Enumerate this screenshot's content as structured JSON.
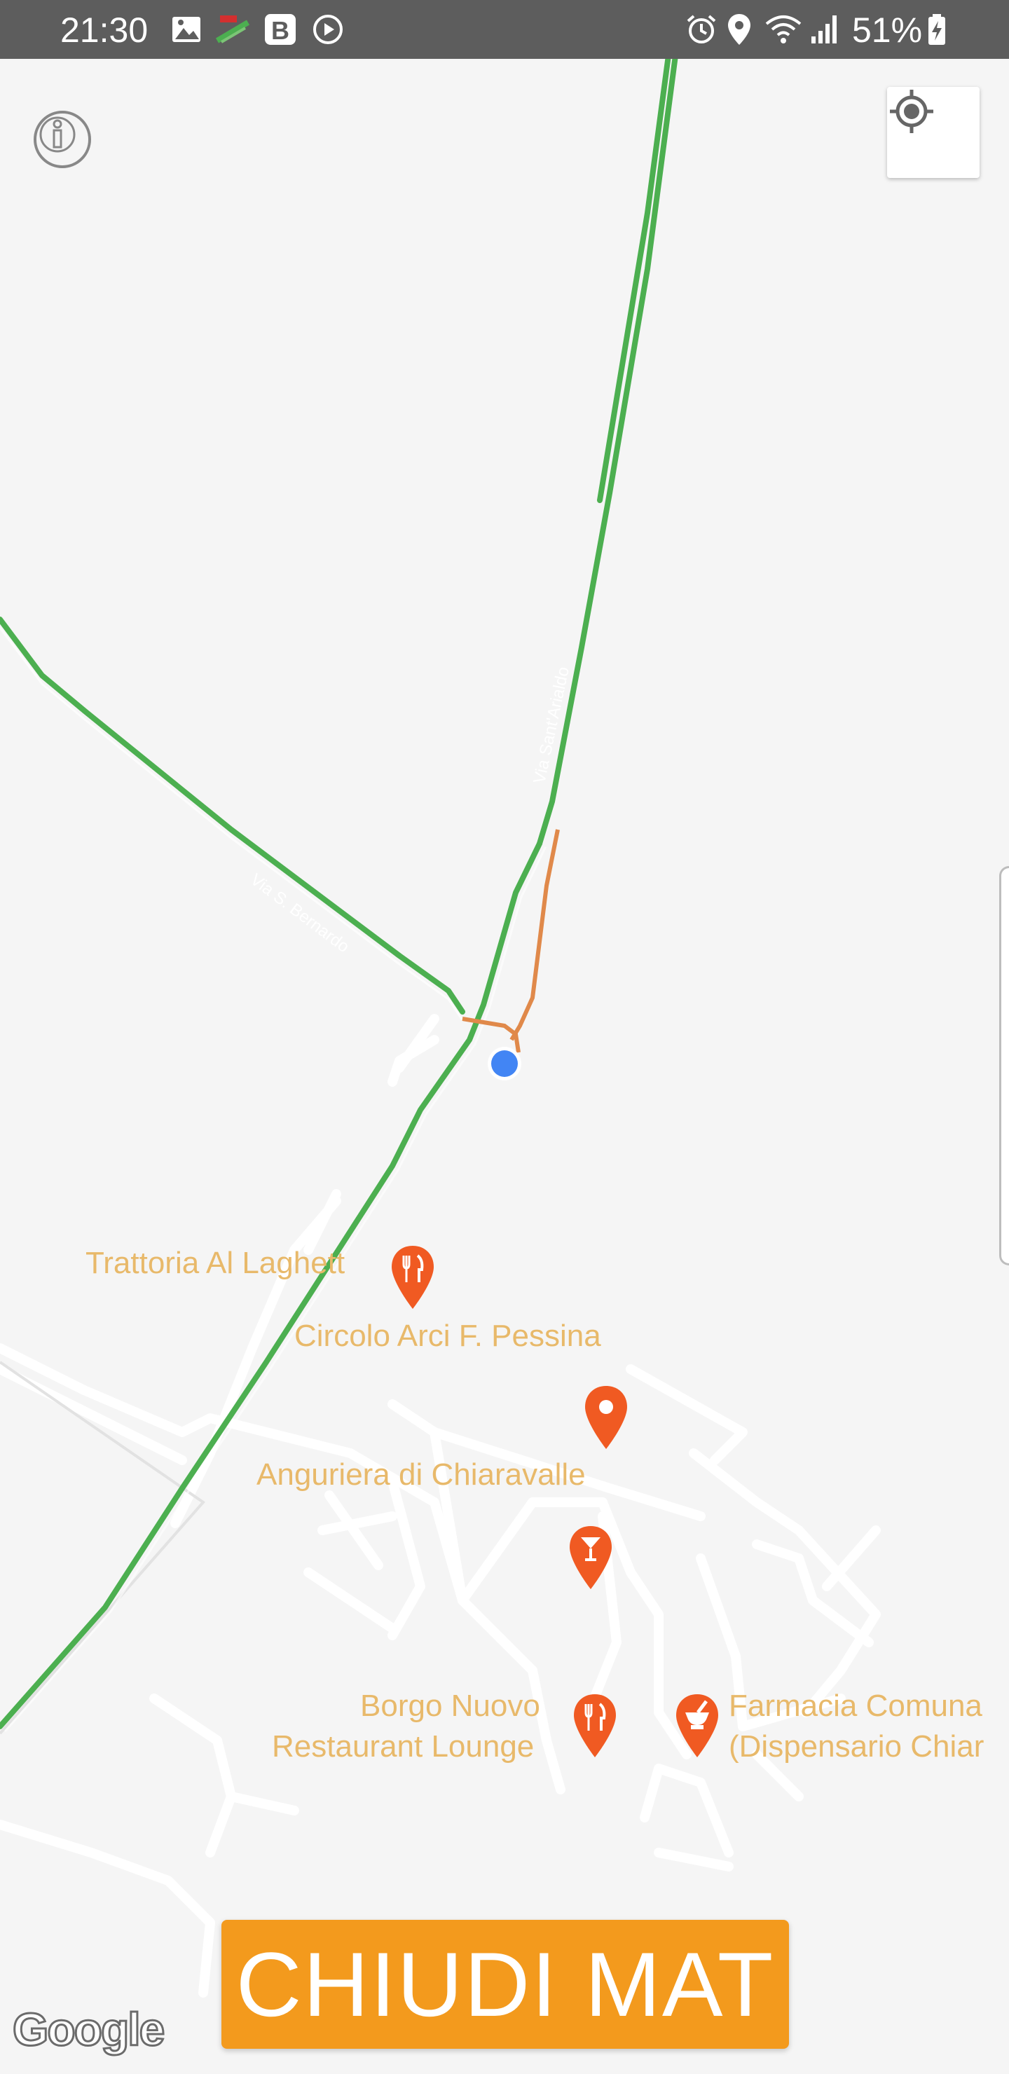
{
  "status_bar": {
    "time": "21:30",
    "battery": "51%",
    "icons": [
      "gallery-icon",
      "app-notification-icon",
      "b-app-icon",
      "play-icon",
      "alarm-icon",
      "location-icon",
      "wifi-icon",
      "signal-icon",
      "battery-charging-icon"
    ]
  },
  "map": {
    "roads": [
      {
        "name": "Via Sant'Arialdo"
      },
      {
        "name": "Via S. Bernardo"
      }
    ],
    "pois": [
      {
        "label": "Trattoria Al Laghett",
        "icon": "restaurant-icon"
      },
      {
        "label": "Circolo Arci F. Pessina",
        "icon": "place-icon"
      },
      {
        "label": "Anguriera di Chiaravalle",
        "icon": "bar-icon"
      },
      {
        "label": "Borgo Nuovo Restaurant Lounge",
        "lines": [
          "Borgo Nuovo",
          "Restaurant Lounge"
        ],
        "icon": "restaurant-icon"
      },
      {
        "label": "Farmacia Comunale (Dispensario Chiar",
        "lines": [
          "Farmacia Comuna",
          "(Dispensario Chiar"
        ],
        "icon": "pharmacy-icon"
      }
    ],
    "colors": {
      "traffic_green": "#5cb85c",
      "traffic_orange": "#e0894a",
      "location_dot": "#4285f4",
      "poi_pin": "#f05a22",
      "poi_label": "#e8b96a"
    },
    "attribution": "Google"
  },
  "buttons": {
    "info_icon": "info-icon",
    "locate_icon": "my-location-icon",
    "close_label": "CHIUDI MAT"
  }
}
